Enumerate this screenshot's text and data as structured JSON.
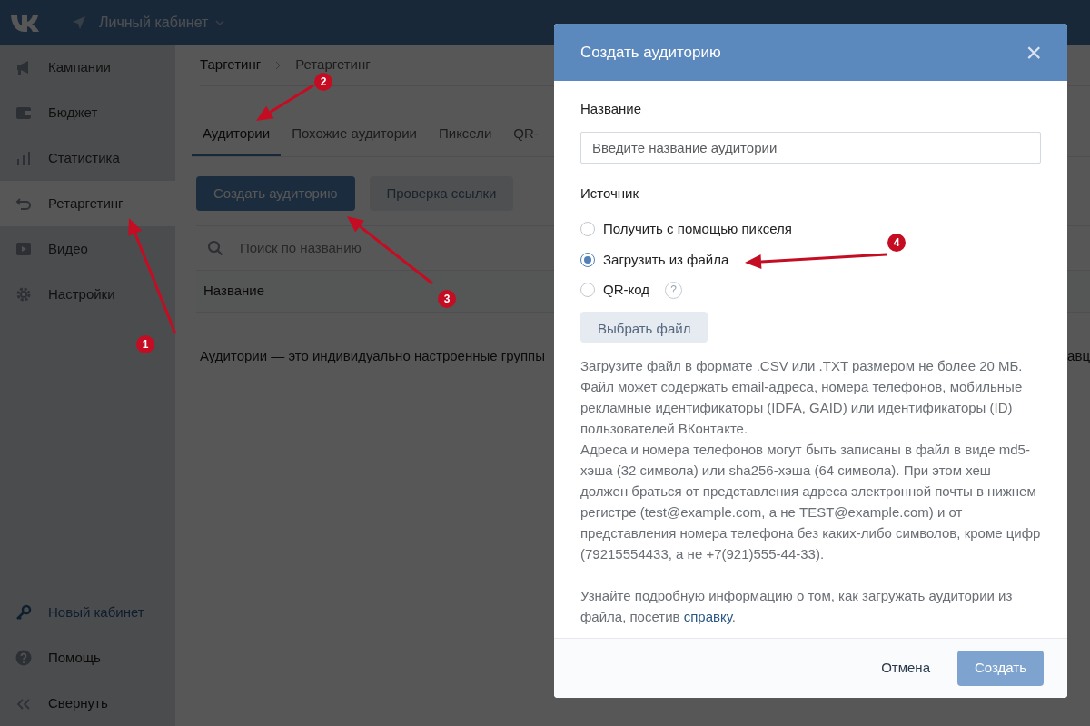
{
  "topbar": {
    "title": "Личный кабинет"
  },
  "sidebar": {
    "items": [
      {
        "label": "Кампании",
        "selected": false
      },
      {
        "label": "Бюджет",
        "selected": false
      },
      {
        "label": "Статистика",
        "selected": false
      },
      {
        "label": "Ретаргетинг",
        "selected": true
      },
      {
        "label": "Видео",
        "selected": false
      },
      {
        "label": "Настройки",
        "selected": false
      }
    ],
    "footer_items": [
      {
        "label": "Новый кабинет",
        "kind": "link"
      },
      {
        "label": "Помощь",
        "kind": "plain"
      },
      {
        "label": "Свернуть",
        "kind": "plain"
      }
    ]
  },
  "breadcrumb": [
    "Таргетинг",
    "Ретаргетинг"
  ],
  "tabs": [
    {
      "label": "Аудитории",
      "selected": true
    },
    {
      "label": "Похожие аудитории",
      "selected": false
    },
    {
      "label": "Пиксели",
      "selected": false
    },
    {
      "label": "QR-",
      "selected": false
    }
  ],
  "buttons": [
    {
      "label": "Создать аудиторию",
      "kind": "primary"
    },
    {
      "label": "Проверка ссылки",
      "kind": "secondary"
    }
  ],
  "search": {
    "placeholder": "Поиск по названию"
  },
  "table": {
    "columns": [
      "Название"
    ]
  },
  "description": [
    "Аудитории — это индивидуально настроенные группы",
    "авц"
  ],
  "modal": {
    "title": "Создать аудиторию",
    "name_label": "Название",
    "name_placeholder": "Введите название аудитории",
    "source_label": "Источник",
    "options": [
      {
        "label": "Получить с помощью пикселя",
        "selected": false,
        "help": false
      },
      {
        "label": "Загрузить из файла",
        "selected": true,
        "help": false
      },
      {
        "label": "QR-код",
        "selected": false,
        "help": true
      }
    ],
    "help_mark": "?",
    "file_button": "Выбрать файл",
    "info": [
      "Загрузите файл в формате .CSV или .TXT размером не более 20 МБ.",
      "Файл может содержать email-адреса, номера телефонов, мобильные рекламные идентификаторы (IDFA, GAID) или идентификаторы (ID) пользователей ВКонтакте.",
      "Адреса и номера телефонов могут быть записаны в файл в виде md5-хэша (32 символа) или sha256-хэша (64 символа). При этом хеш должен браться от представления адреса электронной почты в нижнем регистре (test@example.com, а не TEST@example.com) и от представления номера телефона без каких-либо символов, кроме цифр (79215554433, а не +7(921)555-44-33)."
    ],
    "help_text": "Узнайте подробную информацию о том, как загружать аудитории из файла, посетив",
    "help_link": "справку",
    "help_end": ".",
    "cancel": "Отмена",
    "submit": {
      "label": "Создать",
      "disabled": true
    },
    "close": "×"
  },
  "annotations": [
    {
      "number": "1"
    },
    {
      "number": "2"
    },
    {
      "number": "3"
    },
    {
      "number": "4"
    }
  ]
}
